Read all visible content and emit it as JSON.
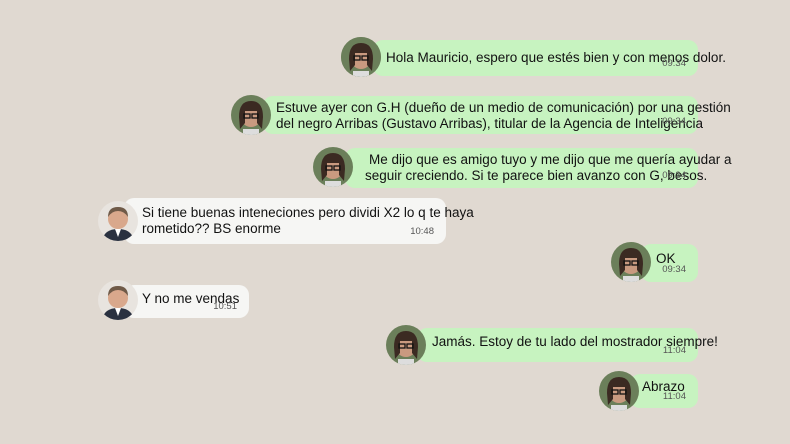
{
  "colors": {
    "background": "#e0d9d1",
    "outgoing_bubble": "#c7f3c0",
    "incoming_bubble": "#f6f6f4",
    "time_text": "#555555"
  },
  "messages": [
    {
      "direction": "outgoing",
      "avatar": "woman-avatar",
      "lines": [
        "Hola Mauricio, espero que estés bien y con menos dolor."
      ],
      "time": "09:34"
    },
    {
      "direction": "outgoing",
      "avatar": "woman-avatar",
      "lines": [
        "Estuve ayer con G.H (dueño de un medio de comunicación) por una gestión",
        "del negro Arribas (Gustavo Arribas), titular de la Agencia de Inteligencia"
      ],
      "time": "09:34"
    },
    {
      "direction": "outgoing",
      "avatar": "woman-avatar",
      "lines": [
        "Me dijo que es amigo tuyo y me dijo que me quería ayudar a",
        "seguir creciendo. Si te parece bien avanzo con G, besos."
      ],
      "time": "09:34"
    },
    {
      "direction": "incoming",
      "avatar": "man-avatar",
      "lines": [
        "Si tiene buenas inteneciones pero dividi X2 lo q te haya",
        "rometido?? BS enorme"
      ],
      "time": "10:48"
    },
    {
      "direction": "outgoing",
      "avatar": "woman-avatar",
      "lines": [
        "OK"
      ],
      "time": "09:34"
    },
    {
      "direction": "incoming",
      "avatar": "man-avatar",
      "lines": [
        "Y no me vendas"
      ],
      "time": "10:51"
    },
    {
      "direction": "outgoing",
      "avatar": "woman-avatar",
      "lines": [
        "Jamás. Estoy de tu lado del mostrador siempre!"
      ],
      "time": "11:04"
    },
    {
      "direction": "outgoing",
      "avatar": "woman-avatar",
      "lines": [
        "Abrazo"
      ],
      "time": "11:04"
    }
  ]
}
